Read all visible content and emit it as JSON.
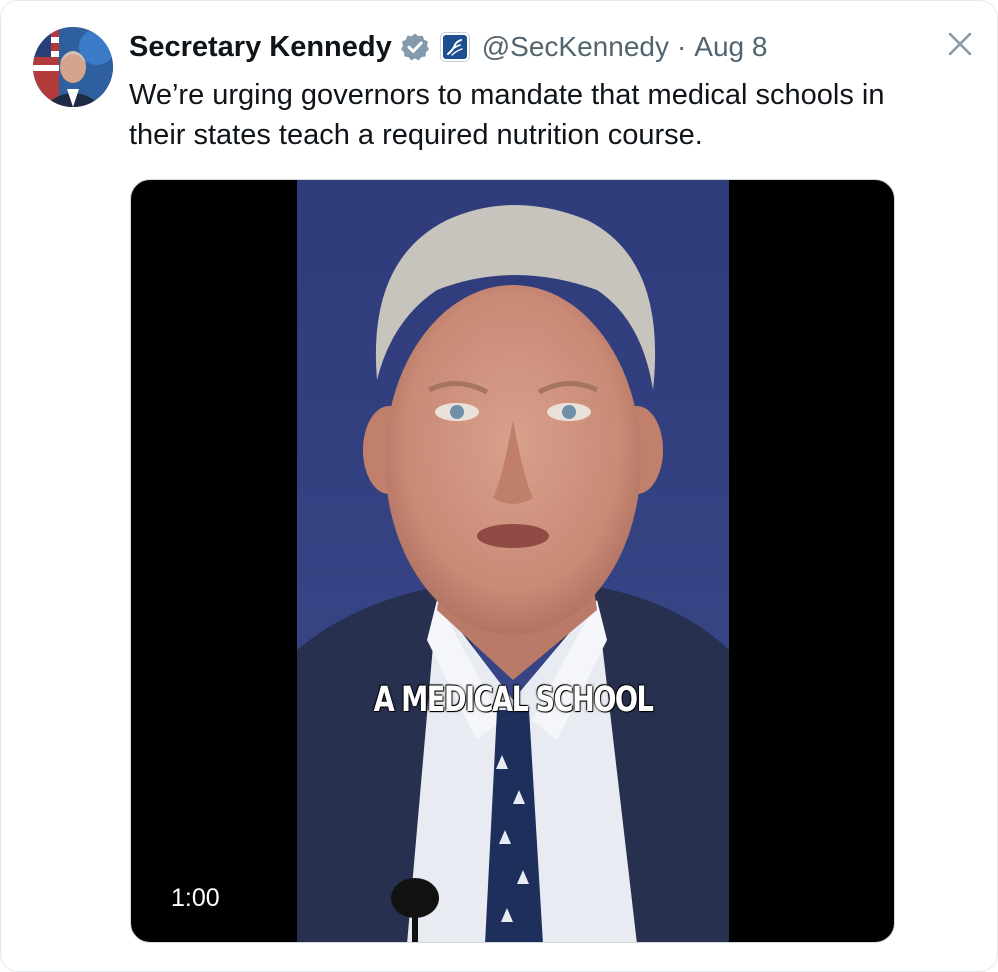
{
  "tweet": {
    "author": {
      "display_name": "Secretary Kennedy",
      "handle": "@SecKennedy",
      "separator": "·",
      "date": "Aug 8",
      "avatar_icon": "profile-photo",
      "verified_icon": "verified-badge-icon",
      "affiliate_icon": "hhs-affiliate-badge-icon"
    },
    "text": "We’re urging governors to mandate that medical schools in their states teach a required nutrition course.",
    "media": {
      "type": "video",
      "caption": "A MEDICAL SCHOOL",
      "duration": "1:00"
    },
    "close_icon": "close-icon"
  },
  "colors": {
    "primary_text": "#0f1419",
    "secondary_text": "#536471",
    "verified_badge": "#829aab",
    "affiliate_badge": "#1d4f91",
    "video_background": "#000000",
    "backdrop_blue": "#333f7e"
  }
}
